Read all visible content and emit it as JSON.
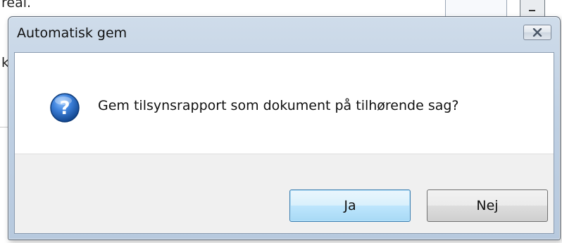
{
  "background": {
    "text_top": "real.",
    "text_left": "k"
  },
  "dialog": {
    "title": "Automatisk gem",
    "close_icon": "close-icon",
    "question_icon": "question-icon",
    "message": "Gem tilsynsrapport som dokument på tilhørende sag?",
    "buttons": {
      "yes_label": "Ja",
      "no_label": "Nej"
    }
  },
  "colors": {
    "title_bar": "#bfd0e3",
    "default_button_border": "#3c7fb1",
    "question_icon_blue": "#1e5fb4"
  }
}
